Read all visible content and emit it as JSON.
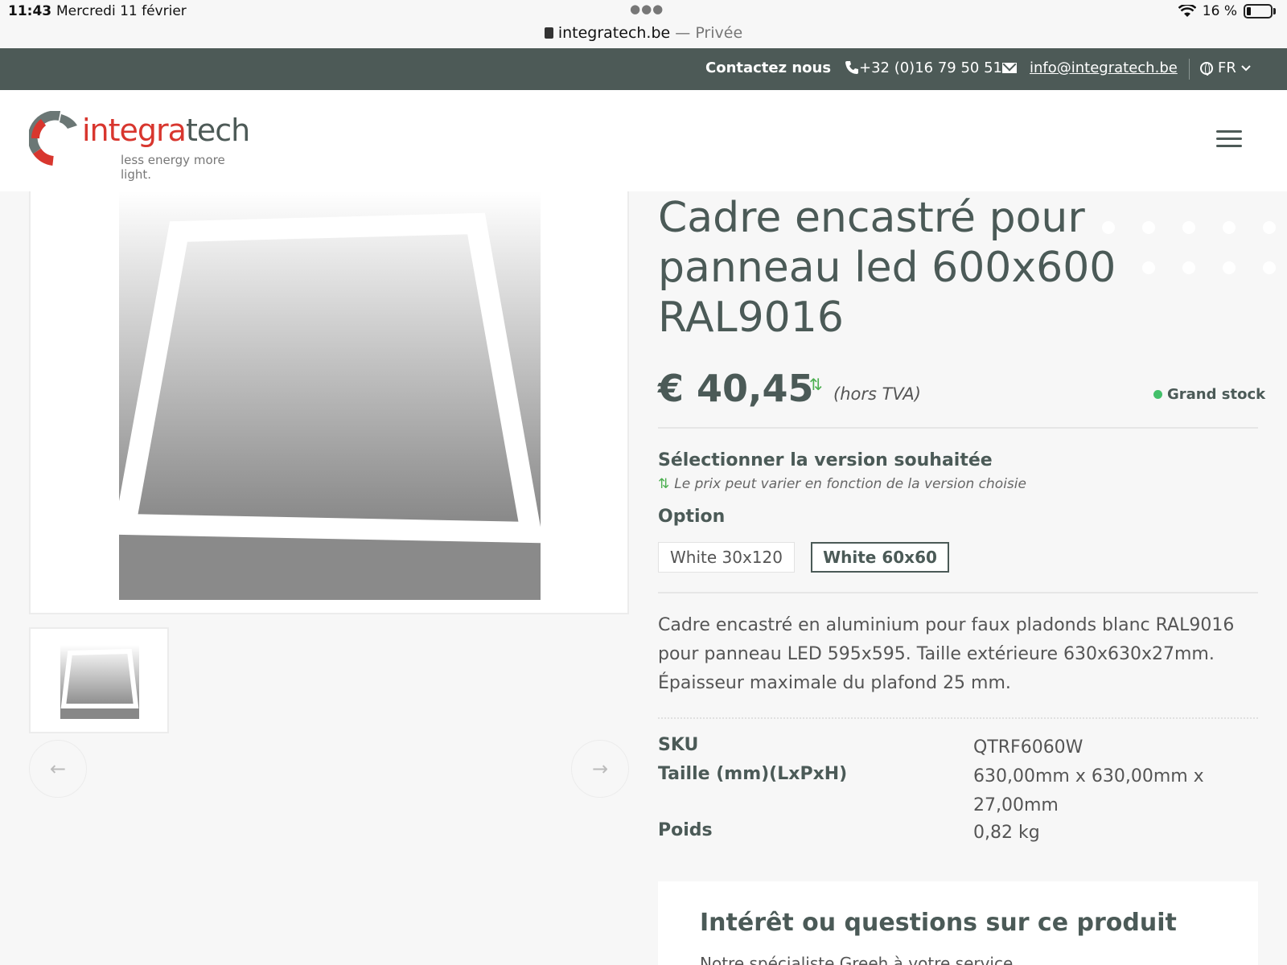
{
  "status_bar": {
    "time": "11:43",
    "date": "Mercredi 11 février",
    "battery": "16 %"
  },
  "browser": {
    "domain": "integratech.be",
    "mode": " — Privée"
  },
  "topbar": {
    "contact_label": "Contactez nous",
    "phone": "+32 (0)16 79 50 51",
    "email": "info@integratech.be",
    "language": "FR"
  },
  "header": {
    "logo_text_1": "integra",
    "logo_text_2": "tech",
    "logo_tagline": "less energy more light."
  },
  "product": {
    "title": "Cadre encastré pour panneau led 600x600 RAL9016",
    "price": "€ 40,45",
    "price_note": "(hors TVA)",
    "stock": "Grand stock",
    "select_title": "Sélectionner la version souhaitée",
    "select_note": "Le prix peut varier en fonction de la version choisie",
    "option_label": "Option",
    "options": [
      "White 30x120",
      "White 60x60"
    ],
    "selected_option": "White 60x60",
    "description": "Cadre encastré en aluminium pour faux pladonds blanc RAL9016 pour panneau LED 595x595. Taille extérieure 630x630x27mm. Épaisseur maximale du plafond 25 mm.",
    "specs": [
      {
        "key": "SKU",
        "value": "QTRF6060W"
      },
      {
        "key": "Taille (mm)(LxPxH)",
        "value": "630,00mm x 630,00mm x 27,00mm"
      },
      {
        "key": "Poids",
        "value": "0,82 kg"
      }
    ]
  },
  "contact_card": {
    "title": "Intérêt ou questions sur ce produit",
    "subtitle": "Notre spécialiste Greeh à votre service"
  },
  "colors": {
    "brand_dark": "#4d5a57",
    "brand_red": "#d8362e",
    "stock_green": "#43c06a"
  }
}
